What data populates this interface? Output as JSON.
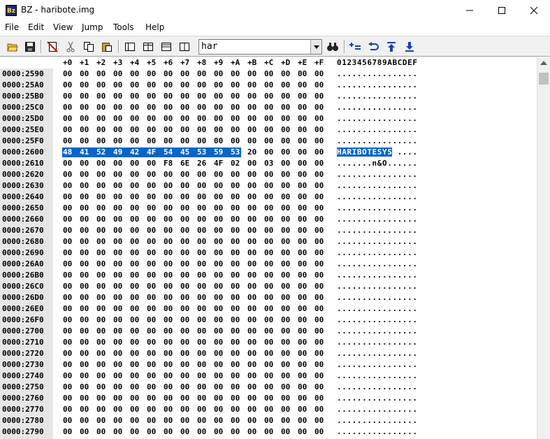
{
  "window": {
    "icon_text": "Bz",
    "title": "BZ - haribote.img"
  },
  "menu": [
    "File",
    "Edit",
    "View",
    "Jump",
    "Tools",
    "Help"
  ],
  "toolbar": {
    "search_value": "har",
    "buttons": [
      {
        "name": "open-icon"
      },
      {
        "name": "save-icon"
      },
      {
        "name": "new-icon"
      },
      {
        "name": "cut-icon"
      },
      {
        "name": "copy-icon"
      },
      {
        "name": "paste-icon"
      },
      {
        "name": "view-single-icon"
      },
      {
        "name": "view-split-vertical-icon"
      },
      {
        "name": "view-split-horizontal-icon"
      },
      {
        "name": "view-split-icon"
      },
      {
        "name": "find-icon"
      },
      {
        "name": "compare-icon"
      },
      {
        "name": "undo-icon"
      },
      {
        "name": "jump-top-icon"
      },
      {
        "name": "download-icon"
      }
    ]
  },
  "header": {
    "offsets": [
      "+0",
      "+1",
      "+2",
      "+3",
      "+4",
      "+5",
      "+6",
      "+7",
      "+8",
      "+9",
      "+A",
      "+B",
      "+C",
      "+D",
      "+E",
      "+F"
    ],
    "ascii": "0123456789ABCDEF"
  },
  "rows": [
    {
      "addr": "0000:2590",
      "bytes": [
        "00",
        "00",
        "00",
        "00",
        "00",
        "00",
        "00",
        "00",
        "00",
        "00",
        "00",
        "00",
        "00",
        "00",
        "00",
        "00"
      ],
      "ascii": "................",
      "sel": 0
    },
    {
      "addr": "0000:25A0",
      "bytes": [
        "00",
        "00",
        "00",
        "00",
        "00",
        "00",
        "00",
        "00",
        "00",
        "00",
        "00",
        "00",
        "00",
        "00",
        "00",
        "00"
      ],
      "ascii": "................",
      "sel": 0
    },
    {
      "addr": "0000:25B0",
      "bytes": [
        "00",
        "00",
        "00",
        "00",
        "00",
        "00",
        "00",
        "00",
        "00",
        "00",
        "00",
        "00",
        "00",
        "00",
        "00",
        "00"
      ],
      "ascii": "................",
      "sel": 0
    },
    {
      "addr": "0000:25C0",
      "bytes": [
        "00",
        "00",
        "00",
        "00",
        "00",
        "00",
        "00",
        "00",
        "00",
        "00",
        "00",
        "00",
        "00",
        "00",
        "00",
        "00"
      ],
      "ascii": "................",
      "sel": 0
    },
    {
      "addr": "0000:25D0",
      "bytes": [
        "00",
        "00",
        "00",
        "00",
        "00",
        "00",
        "00",
        "00",
        "00",
        "00",
        "00",
        "00",
        "00",
        "00",
        "00",
        "00"
      ],
      "ascii": "................",
      "sel": 0
    },
    {
      "addr": "0000:25E0",
      "bytes": [
        "00",
        "00",
        "00",
        "00",
        "00",
        "00",
        "00",
        "00",
        "00",
        "00",
        "00",
        "00",
        "00",
        "00",
        "00",
        "00"
      ],
      "ascii": "................",
      "sel": 0
    },
    {
      "addr": "0000:25F0",
      "bytes": [
        "00",
        "00",
        "00",
        "00",
        "00",
        "00",
        "00",
        "00",
        "00",
        "00",
        "00",
        "00",
        "00",
        "00",
        "00",
        "00"
      ],
      "ascii": "................",
      "sel": 0
    },
    {
      "addr": "0000:2600",
      "bytes": [
        "48",
        "41",
        "52",
        "49",
        "42",
        "4F",
        "54",
        "45",
        "53",
        "59",
        "53",
        "20",
        "00",
        "00",
        "00",
        "00"
      ],
      "ascii": "HARIBOTESYS ....",
      "sel": 11
    },
    {
      "addr": "0000:2610",
      "bytes": [
        "00",
        "00",
        "00",
        "00",
        "00",
        "00",
        "F8",
        "6E",
        "26",
        "4F",
        "02",
        "00",
        "03",
        "00",
        "00",
        "00"
      ],
      "ascii": ".......n&O......",
      "sel": 0
    },
    {
      "addr": "0000:2620",
      "bytes": [
        "00",
        "00",
        "00",
        "00",
        "00",
        "00",
        "00",
        "00",
        "00",
        "00",
        "00",
        "00",
        "00",
        "00",
        "00",
        "00"
      ],
      "ascii": "................",
      "sel": 0
    },
    {
      "addr": "0000:2630",
      "bytes": [
        "00",
        "00",
        "00",
        "00",
        "00",
        "00",
        "00",
        "00",
        "00",
        "00",
        "00",
        "00",
        "00",
        "00",
        "00",
        "00"
      ],
      "ascii": "................",
      "sel": 0
    },
    {
      "addr": "0000:2640",
      "bytes": [
        "00",
        "00",
        "00",
        "00",
        "00",
        "00",
        "00",
        "00",
        "00",
        "00",
        "00",
        "00",
        "00",
        "00",
        "00",
        "00"
      ],
      "ascii": "................",
      "sel": 0
    },
    {
      "addr": "0000:2650",
      "bytes": [
        "00",
        "00",
        "00",
        "00",
        "00",
        "00",
        "00",
        "00",
        "00",
        "00",
        "00",
        "00",
        "00",
        "00",
        "00",
        "00"
      ],
      "ascii": "................",
      "sel": 0
    },
    {
      "addr": "0000:2660",
      "bytes": [
        "00",
        "00",
        "00",
        "00",
        "00",
        "00",
        "00",
        "00",
        "00",
        "00",
        "00",
        "00",
        "00",
        "00",
        "00",
        "00"
      ],
      "ascii": "................",
      "sel": 0
    },
    {
      "addr": "0000:2670",
      "bytes": [
        "00",
        "00",
        "00",
        "00",
        "00",
        "00",
        "00",
        "00",
        "00",
        "00",
        "00",
        "00",
        "00",
        "00",
        "00",
        "00"
      ],
      "ascii": "................",
      "sel": 0
    },
    {
      "addr": "0000:2680",
      "bytes": [
        "00",
        "00",
        "00",
        "00",
        "00",
        "00",
        "00",
        "00",
        "00",
        "00",
        "00",
        "00",
        "00",
        "00",
        "00",
        "00"
      ],
      "ascii": "................",
      "sel": 0
    },
    {
      "addr": "0000:2690",
      "bytes": [
        "00",
        "00",
        "00",
        "00",
        "00",
        "00",
        "00",
        "00",
        "00",
        "00",
        "00",
        "00",
        "00",
        "00",
        "00",
        "00"
      ],
      "ascii": "................",
      "sel": 0
    },
    {
      "addr": "0000:26A0",
      "bytes": [
        "00",
        "00",
        "00",
        "00",
        "00",
        "00",
        "00",
        "00",
        "00",
        "00",
        "00",
        "00",
        "00",
        "00",
        "00",
        "00"
      ],
      "ascii": "................",
      "sel": 0
    },
    {
      "addr": "0000:26B0",
      "bytes": [
        "00",
        "00",
        "00",
        "00",
        "00",
        "00",
        "00",
        "00",
        "00",
        "00",
        "00",
        "00",
        "00",
        "00",
        "00",
        "00"
      ],
      "ascii": "................",
      "sel": 0
    },
    {
      "addr": "0000:26C0",
      "bytes": [
        "00",
        "00",
        "00",
        "00",
        "00",
        "00",
        "00",
        "00",
        "00",
        "00",
        "00",
        "00",
        "00",
        "00",
        "00",
        "00"
      ],
      "ascii": "................",
      "sel": 0
    },
    {
      "addr": "0000:26D0",
      "bytes": [
        "00",
        "00",
        "00",
        "00",
        "00",
        "00",
        "00",
        "00",
        "00",
        "00",
        "00",
        "00",
        "00",
        "00",
        "00",
        "00"
      ],
      "ascii": "................",
      "sel": 0
    },
    {
      "addr": "0000:26E0",
      "bytes": [
        "00",
        "00",
        "00",
        "00",
        "00",
        "00",
        "00",
        "00",
        "00",
        "00",
        "00",
        "00",
        "00",
        "00",
        "00",
        "00"
      ],
      "ascii": "................",
      "sel": 0
    },
    {
      "addr": "0000:26F0",
      "bytes": [
        "00",
        "00",
        "00",
        "00",
        "00",
        "00",
        "00",
        "00",
        "00",
        "00",
        "00",
        "00",
        "00",
        "00",
        "00",
        "00"
      ],
      "ascii": "................",
      "sel": 0
    },
    {
      "addr": "0000:2700",
      "bytes": [
        "00",
        "00",
        "00",
        "00",
        "00",
        "00",
        "00",
        "00",
        "00",
        "00",
        "00",
        "00",
        "00",
        "00",
        "00",
        "00"
      ],
      "ascii": "................",
      "sel": 0
    },
    {
      "addr": "0000:2710",
      "bytes": [
        "00",
        "00",
        "00",
        "00",
        "00",
        "00",
        "00",
        "00",
        "00",
        "00",
        "00",
        "00",
        "00",
        "00",
        "00",
        "00"
      ],
      "ascii": "................",
      "sel": 0
    },
    {
      "addr": "0000:2720",
      "bytes": [
        "00",
        "00",
        "00",
        "00",
        "00",
        "00",
        "00",
        "00",
        "00",
        "00",
        "00",
        "00",
        "00",
        "00",
        "00",
        "00"
      ],
      "ascii": "................",
      "sel": 0
    },
    {
      "addr": "0000:2730",
      "bytes": [
        "00",
        "00",
        "00",
        "00",
        "00",
        "00",
        "00",
        "00",
        "00",
        "00",
        "00",
        "00",
        "00",
        "00",
        "00",
        "00"
      ],
      "ascii": "................",
      "sel": 0
    },
    {
      "addr": "0000:2740",
      "bytes": [
        "00",
        "00",
        "00",
        "00",
        "00",
        "00",
        "00",
        "00",
        "00",
        "00",
        "00",
        "00",
        "00",
        "00",
        "00",
        "00"
      ],
      "ascii": "................",
      "sel": 0
    },
    {
      "addr": "0000:2750",
      "bytes": [
        "00",
        "00",
        "00",
        "00",
        "00",
        "00",
        "00",
        "00",
        "00",
        "00",
        "00",
        "00",
        "00",
        "00",
        "00",
        "00"
      ],
      "ascii": "................",
      "sel": 0
    },
    {
      "addr": "0000:2760",
      "bytes": [
        "00",
        "00",
        "00",
        "00",
        "00",
        "00",
        "00",
        "00",
        "00",
        "00",
        "00",
        "00",
        "00",
        "00",
        "00",
        "00"
      ],
      "ascii": "................",
      "sel": 0
    },
    {
      "addr": "0000:2770",
      "bytes": [
        "00",
        "00",
        "00",
        "00",
        "00",
        "00",
        "00",
        "00",
        "00",
        "00",
        "00",
        "00",
        "00",
        "00",
        "00",
        "00"
      ],
      "ascii": "................",
      "sel": 0
    },
    {
      "addr": "0000:2780",
      "bytes": [
        "00",
        "00",
        "00",
        "00",
        "00",
        "00",
        "00",
        "00",
        "00",
        "00",
        "00",
        "00",
        "00",
        "00",
        "00",
        "00"
      ],
      "ascii": "................",
      "sel": 0
    },
    {
      "addr": "0000:2790",
      "bytes": [
        "00",
        "00",
        "00",
        "00",
        "00",
        "00",
        "00",
        "00",
        "00",
        "00",
        "00",
        "00",
        "00",
        "00",
        "00",
        "00"
      ],
      "ascii": "................",
      "sel": 0
    }
  ],
  "colors": {
    "selection": "#0a64c8",
    "address_column": "#e6e6e6",
    "toolbar": "#f0f0f0"
  }
}
